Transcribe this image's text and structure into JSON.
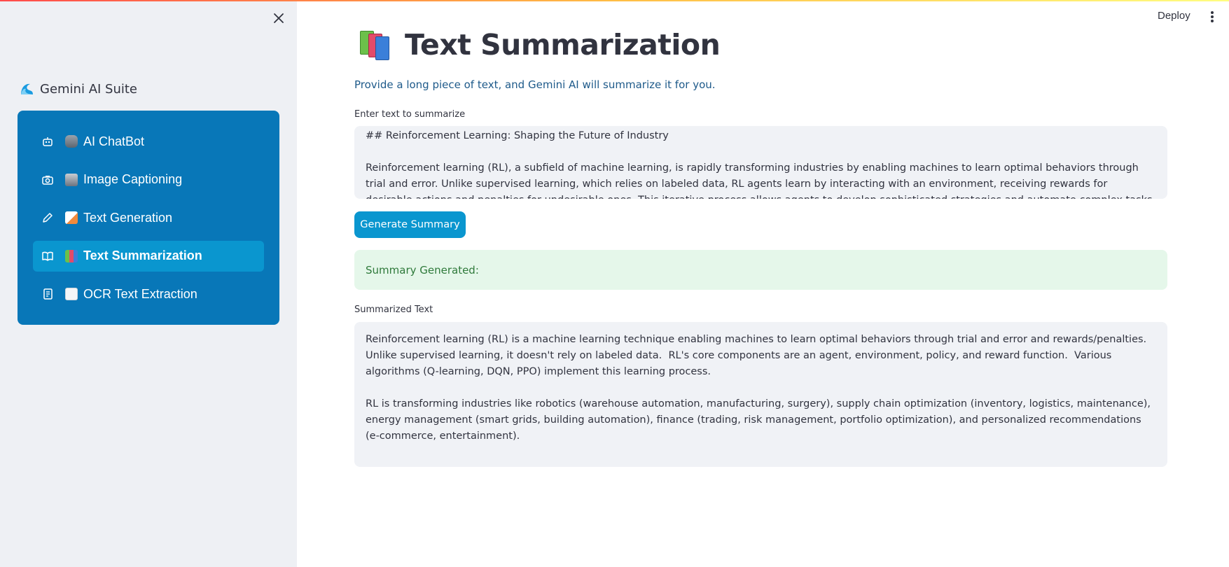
{
  "app": {
    "brand_title": "Gemini AI Suite",
    "deploy_label": "Deploy"
  },
  "sidebar": {
    "items": [
      {
        "label": "AI ChatBot",
        "icon": "robot-icon",
        "emoji": "robot-face"
      },
      {
        "label": "Image Captioning",
        "icon": "camera-icon",
        "emoji": "camera"
      },
      {
        "label": "Text Generation",
        "icon": "pencil-icon",
        "emoji": "memo"
      },
      {
        "label": "Text Summarization",
        "icon": "book-open-icon",
        "emoji": "books",
        "active": true
      },
      {
        "label": "OCR Text Extraction",
        "icon": "document-icon",
        "emoji": "page"
      }
    ]
  },
  "main": {
    "title": "Text Summarization",
    "subtitle": "Provide a long piece of text, and Gemini AI will summarize it for you.",
    "input_label": "Enter text to summarize",
    "input_value": "## Reinforcement Learning: Shaping the Future of Industry\n\nReinforcement learning (RL), a subfield of machine learning, is rapidly transforming industries by enabling machines to learn optimal behaviors through trial and error. Unlike supervised learning, which relies on labeled data, RL agents learn by interacting with an environment, receiving rewards for desirable actions and penalties for undesirable ones. This iterative process allows agents to develop sophisticated strategies and automate complex tasks, leading to significant",
    "button_label": "Generate Summary",
    "success_message": "Summary Generated:",
    "output_label": "Summarized Text",
    "output_value": "Reinforcement learning (RL) is a machine learning technique enabling machines to learn optimal behaviors through trial and error and rewards/penalties.  Unlike supervised learning, it doesn't rely on labeled data.  RL's core components are an agent, environment, policy, and reward function.  Various algorithms (Q-learning, DQN, PPO) implement this learning process.\n\nRL is transforming industries like robotics (warehouse automation, manufacturing, surgery), supply chain optimization (inventory, logistics, maintenance), energy management (smart grids, building automation), finance (trading, risk management, portfolio optimization), and personalized recommendations (e-commerce, entertainment)."
  },
  "colors": {
    "sidebar_card": "#0877b8",
    "active_item": "#0a96cf",
    "primary_button": "#0a96cf",
    "success_bg": "#e5f7ea"
  }
}
